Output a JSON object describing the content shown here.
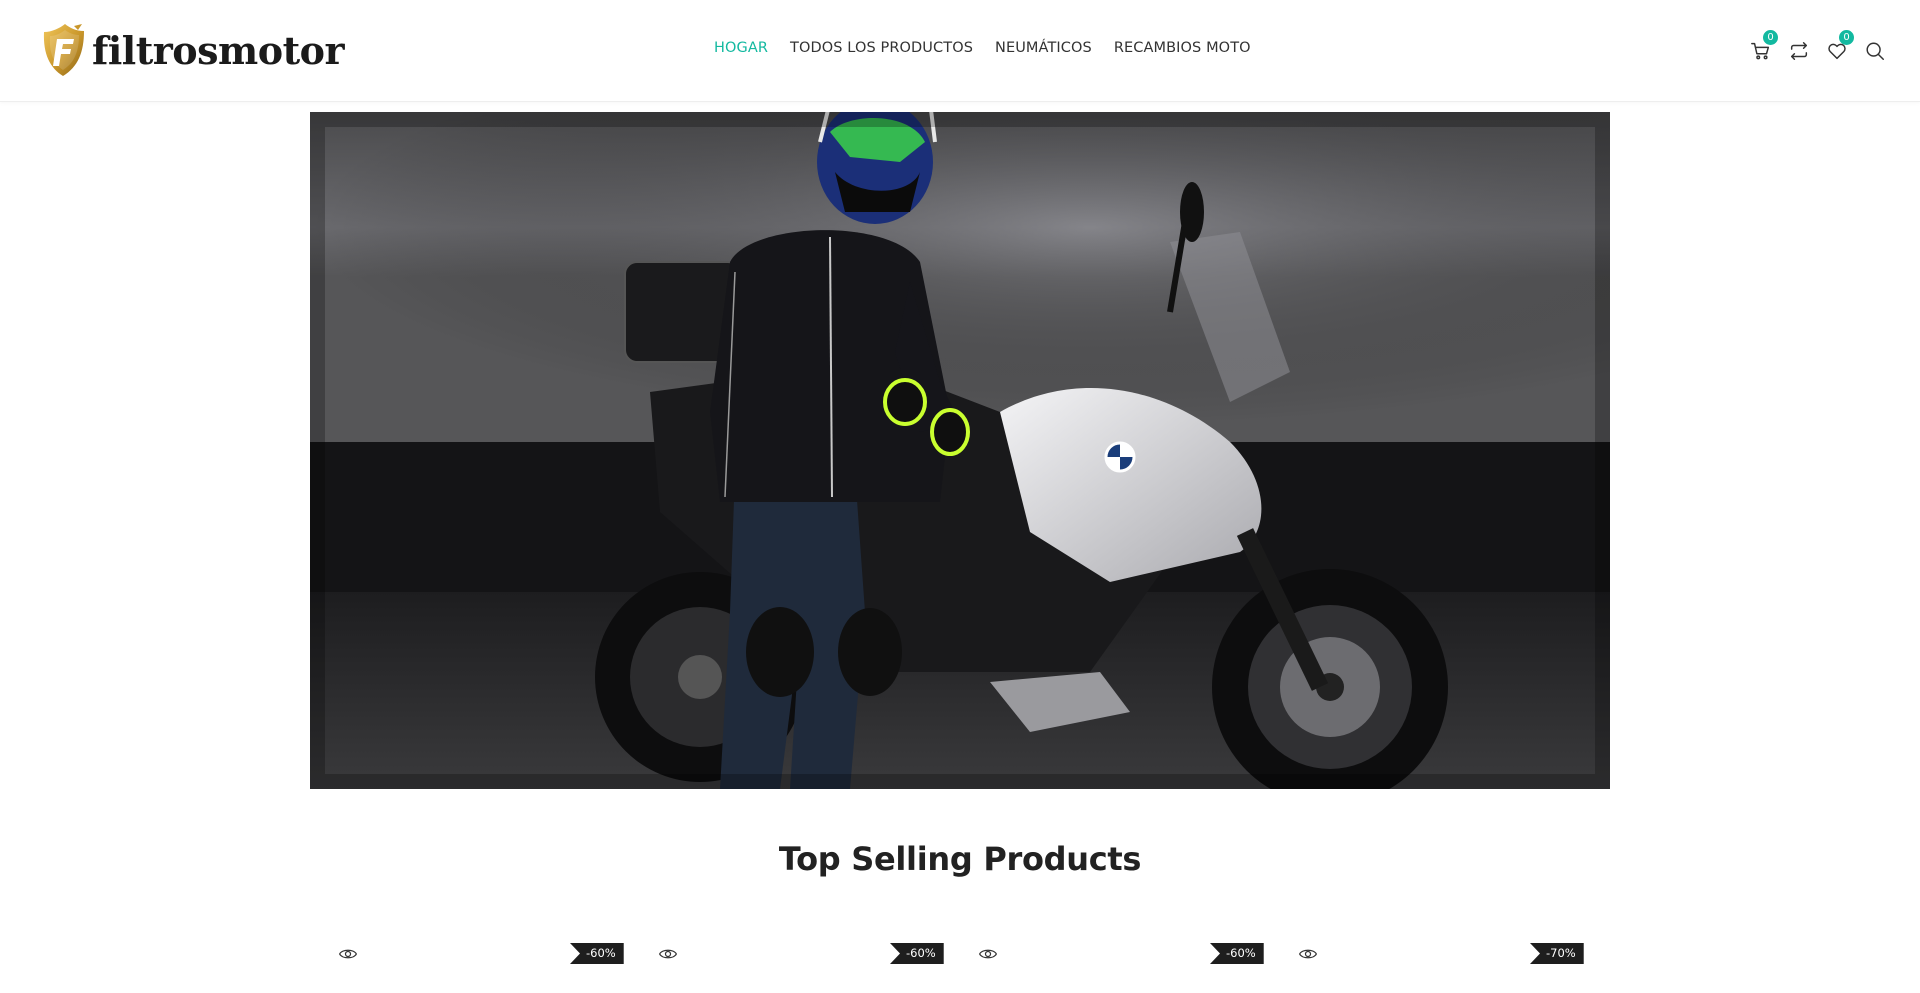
{
  "header": {
    "logo_text": "filtrosmotor",
    "nav": [
      {
        "label": "HOGAR",
        "active": true
      },
      {
        "label": "TODOS LOS PRODUCTOS",
        "active": false
      },
      {
        "label": "NEUMÁTICOS",
        "active": false
      },
      {
        "label": "RECAMBIOS MOTO",
        "active": false
      }
    ],
    "icons": {
      "cart": {
        "icon": "cart-icon",
        "count": "0"
      },
      "compare": {
        "icon": "compare-icon"
      },
      "wishlist": {
        "icon": "heart-icon",
        "count": "0"
      },
      "search": {
        "icon": "search-icon"
      }
    }
  },
  "hero": {
    "icon": "hero-banner-motorcycle-rider-image"
  },
  "section": {
    "title": "Top Selling Products"
  },
  "products": [
    {
      "discount": "-60%",
      "icon": "eye-icon"
    },
    {
      "discount": "-60%",
      "icon": "eye-icon"
    },
    {
      "discount": "-60%",
      "icon": "eye-icon"
    },
    {
      "discount": "-70%",
      "icon": "eye-icon"
    }
  ],
  "colors": {
    "accent": "#13b9a0",
    "logo_gold": "#c9962a",
    "text": "#222222",
    "badge_dark": "#1e1e1e"
  }
}
